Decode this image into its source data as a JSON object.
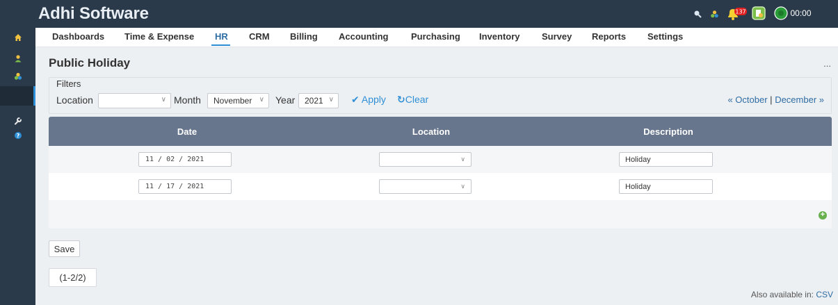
{
  "app": {
    "title": "Adhi Software"
  },
  "topbar": {
    "notification_count": "137",
    "timer": "00:00"
  },
  "menu": [
    {
      "label": "Dashboards"
    },
    {
      "label": "Time & Expense"
    },
    {
      "label": "HR",
      "active": true
    },
    {
      "label": "CRM"
    },
    {
      "label": "Billing"
    },
    {
      "label": "Accounting"
    },
    {
      "label": "Purchasing"
    },
    {
      "label": "Inventory"
    },
    {
      "label": "Survey"
    },
    {
      "label": "Reports"
    },
    {
      "label": "Settings"
    }
  ],
  "page": {
    "title": "Public Holiday",
    "more": "..."
  },
  "filters": {
    "legend": "Filters",
    "location_label": "Location",
    "location_value": "",
    "month_label": "Month",
    "month_value": "November",
    "year_label": "Year",
    "year_value": "2021",
    "apply": "Apply",
    "clear": "Clear",
    "prev": "« October",
    "separator": "|",
    "next": "December »"
  },
  "grid": {
    "columns": [
      "Date",
      "Location",
      "Description"
    ],
    "rows": [
      {
        "date": "11 / 02 / 2021",
        "location": "",
        "description": "Holiday"
      },
      {
        "date": "11 / 17 / 2021",
        "location": "",
        "description": "Holiday"
      }
    ]
  },
  "save_label": "Save",
  "pager": "(1-2/2)",
  "footer": {
    "also_label": "Also available in:",
    "csv": "CSV"
  },
  "colors": {
    "sidebar": "#2b3a4a",
    "grid_header": "#67768d",
    "accent": "#2e8fd6",
    "notification": "#e02020"
  }
}
